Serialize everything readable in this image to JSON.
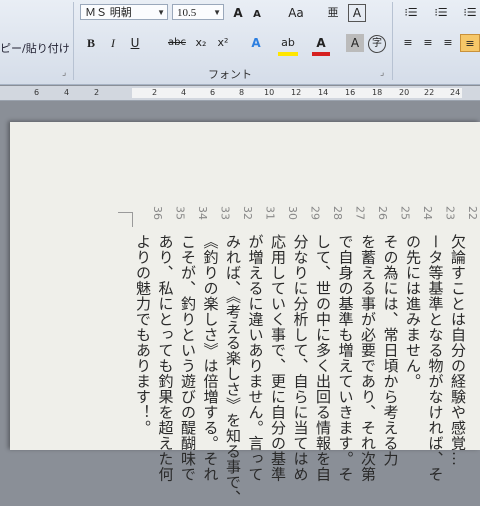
{
  "ribbon": {
    "clipboard_label": "ピー/貼り付け",
    "font_name": "ＭＳ 明朝",
    "font_size": "10.5",
    "grow_font": "A",
    "shrink_font": "A",
    "change_case": "Aa",
    "phonetic": "亜",
    "char_border": "A",
    "bold": "B",
    "italic": "I",
    "underline": "U",
    "strike": "abc",
    "subscript": "x₂",
    "superscript": "x²",
    "text_effect": "A",
    "highlight": "ab",
    "font_color": "A",
    "char_shading": "A",
    "enclose": "字",
    "font_group_label": "フォント"
  },
  "ruler": {
    "left_ticks": [
      "6",
      "4",
      "2"
    ],
    "right_ticks": [
      "2",
      "4",
      "6",
      "8",
      "10",
      "12",
      "14",
      "16",
      "18",
      "20",
      "22",
      "24"
    ]
  },
  "document": {
    "lines": [
      {
        "num": "22",
        "text": "欠論すことは自分の経験や感覚…"
      },
      {
        "num": "23",
        "text": "ータ等基準となる物がなければ、そ"
      },
      {
        "num": "24",
        "text": "の先には進みません。"
      },
      {
        "num": "25",
        "text": "その為には、常日頃から考える力"
      },
      {
        "num": "26",
        "text": "を蓄える事が必要であり、それ次第"
      },
      {
        "num": "27",
        "text": "で自身の基準も増えていきます。そ"
      },
      {
        "num": "28",
        "text": "して、世の中に多く出回る情報を自"
      },
      {
        "num": "29",
        "text": "分なりに分析して、自らに当てはめ"
      },
      {
        "num": "30",
        "text": "応用していく事で、更に自分の基準"
      },
      {
        "num": "31",
        "text": "が増えるに違いありません。言って"
      },
      {
        "num": "32",
        "text": "みれば、《考える楽しさ》を知る事で、"
      },
      {
        "num": "33",
        "text": "《釣りの楽しさ》は倍増する。それ"
      },
      {
        "num": "34",
        "text": "こそが、釣りという遊びの醍醐味で"
      },
      {
        "num": "35",
        "text": "あり、私にとっても釣果を超えた何"
      },
      {
        "num": "36",
        "text": "よりの魅力でもあります！。"
      }
    ]
  }
}
